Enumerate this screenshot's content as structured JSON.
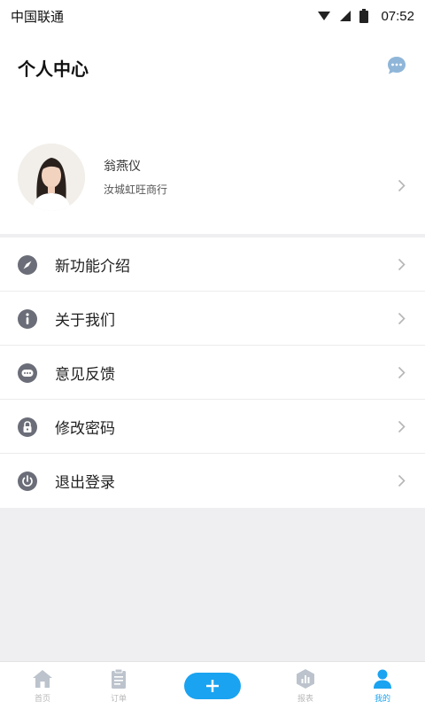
{
  "status_bar": {
    "carrier": "中国联通",
    "time": "07:52"
  },
  "header": {
    "title": "个人中心",
    "chat_icon": "chat-bubble-icon"
  },
  "profile": {
    "name": "翁燕仪",
    "company": "汝城虹旺商行"
  },
  "menu": {
    "items": [
      {
        "label": "新功能介绍",
        "icon": "compass-icon"
      },
      {
        "label": "关于我们",
        "icon": "info-icon"
      },
      {
        "label": "意见反馈",
        "icon": "feedback-icon"
      },
      {
        "label": "修改密码",
        "icon": "lock-icon"
      },
      {
        "label": "退出登录",
        "icon": "power-icon"
      }
    ]
  },
  "tabbar": {
    "items": [
      {
        "label": "首页",
        "icon": "home-icon"
      },
      {
        "label": "订单",
        "icon": "clipboard-icon"
      },
      {
        "label": "",
        "icon": "plus-icon"
      },
      {
        "label": "报表",
        "icon": "report-icon"
      },
      {
        "label": "我的",
        "icon": "user-icon",
        "active": true
      }
    ]
  },
  "colors": {
    "accent": "#1aa3f0",
    "icon_gray": "#6b6e78",
    "chevron": "#b5b5b5",
    "background": "#efeff1"
  }
}
